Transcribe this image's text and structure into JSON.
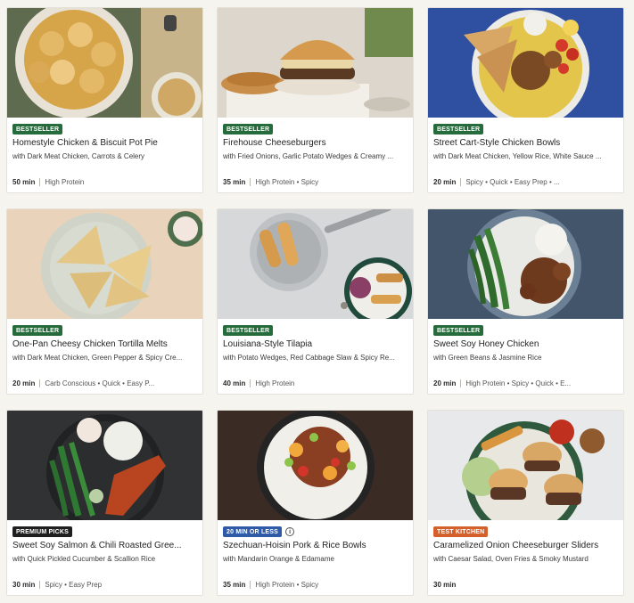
{
  "colors": {
    "bestseller": "#256b3b",
    "premium": "#1f1f1f",
    "twenty_min": "#2f5aa8",
    "test_kitchen": "#d4612c"
  },
  "recipes": [
    {
      "badge": "BESTSELLER",
      "badge_kind": "bestseller",
      "title": "Homestyle Chicken & Biscuit Pot Pie",
      "subtitle": "with Dark Meat Chicken, Carrots & Celery",
      "time": "50 min",
      "tags": "High Protein",
      "image_icon": "pot-pie-image"
    },
    {
      "badge": "BESTSELLER",
      "badge_kind": "bestseller",
      "title": "Firehouse Cheeseburgers",
      "subtitle": "with Fried Onions, Garlic Potato Wedges & Creamy ...",
      "time": "35 min",
      "tags": "High Protein • Spicy",
      "image_icon": "cheeseburger-image"
    },
    {
      "badge": "BESTSELLER",
      "badge_kind": "bestseller",
      "title": "Street Cart-Style Chicken Bowls",
      "subtitle": "with Dark Meat Chicken, Yellow Rice, White Sauce ...",
      "time": "20 min",
      "tags": "Spicy • Quick • Easy Prep • ...",
      "image_icon": "chicken-bowl-image"
    },
    {
      "badge": "BESTSELLER",
      "badge_kind": "bestseller",
      "title": "One-Pan Cheesy Chicken Tortilla Melts",
      "subtitle": "with Dark Meat Chicken, Green Pepper & Spicy Cre...",
      "time": "20 min",
      "tags": "Carb Conscious • Quick • Easy P...",
      "image_icon": "tortilla-melt-image"
    },
    {
      "badge": "BESTSELLER",
      "badge_kind": "bestseller",
      "title": "Louisiana-Style Tilapia",
      "subtitle": "with Potato Wedges, Red Cabbage Slaw & Spicy Re...",
      "time": "40 min",
      "tags": "High Protein",
      "image_icon": "tilapia-image"
    },
    {
      "badge": "BESTSELLER",
      "badge_kind": "bestseller",
      "title": "Sweet Soy Honey Chicken",
      "subtitle": "with Green Beans & Jasmine Rice",
      "time": "20 min",
      "tags": "High Protein • Spicy • Quick • E...",
      "image_icon": "honey-chicken-image"
    },
    {
      "badge": "PREMIUM PICKS",
      "badge_kind": "premium",
      "title": "Sweet Soy Salmon & Chili Roasted Gree...",
      "subtitle": "with Quick Pickled Cucumber & Scallion Rice",
      "time": "30 min",
      "tags": "Spicy • Easy Prep",
      "image_icon": "salmon-image"
    },
    {
      "badge": "20 MIN OR LESS",
      "badge_kind": "twenty_min",
      "info": "i",
      "title": "Szechuan-Hoisin Pork & Rice Bowls",
      "subtitle": "with Mandarin Orange & Edamame",
      "time": "35 min",
      "tags": "High Protein • Spicy",
      "image_icon": "pork-bowl-image"
    },
    {
      "badge": "TEST KITCHEN",
      "badge_kind": "test_kitchen",
      "title": "Caramelized Onion Cheeseburger Sliders",
      "subtitle": "with Caesar Salad, Oven Fries & Smoky Mustard",
      "time": "30 min",
      "tags": "",
      "image_icon": "sliders-image"
    }
  ]
}
